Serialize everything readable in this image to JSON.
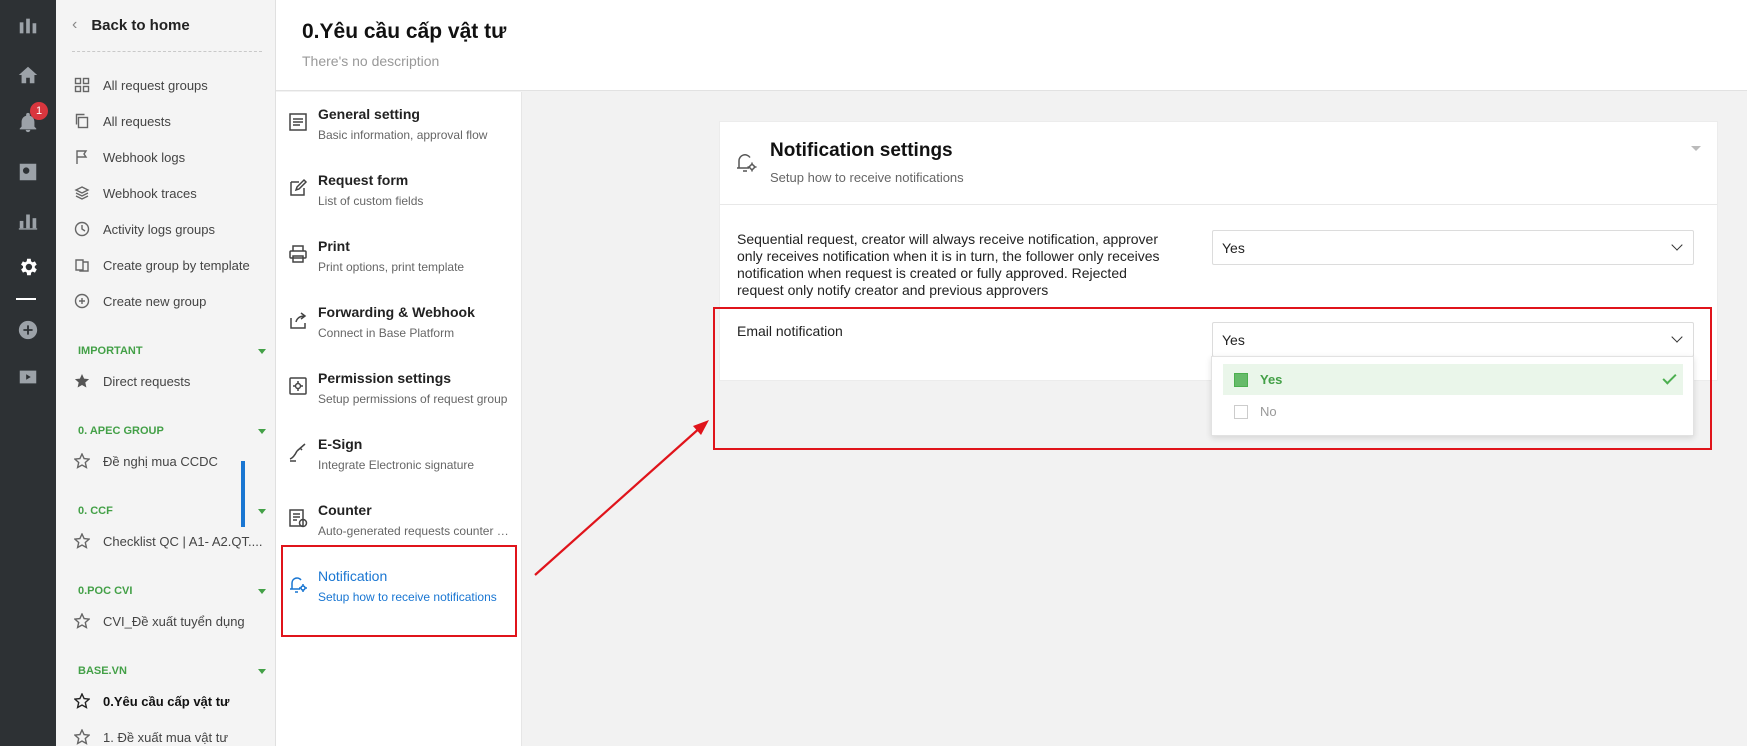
{
  "rail": {
    "notification_badge": "1",
    "icons": [
      "logo-icon",
      "home-icon",
      "bell-icon",
      "search-icon",
      "chart-icon",
      "settings-icon",
      "add-icon",
      "video-icon"
    ]
  },
  "groups_nav": {
    "back_label": "Back to home",
    "items": [
      {
        "label": "All request groups",
        "icon": "grid-icon"
      },
      {
        "label": "All requests",
        "icon": "copy-icon"
      },
      {
        "label": "Webhook logs",
        "icon": "flag-icon"
      },
      {
        "label": "Webhook traces",
        "icon": "layers-icon"
      },
      {
        "label": "Activity logs groups",
        "icon": "clock-icon"
      },
      {
        "label": "Create group by template",
        "icon": "template-icon"
      },
      {
        "label": "Create new group",
        "icon": "plus-circle-icon"
      }
    ],
    "sections": [
      {
        "title": "IMPORTANT",
        "items": [
          "Direct requests"
        ]
      },
      {
        "title": "0. APEC GROUP",
        "items": [
          "Đề nghị mua CCDC"
        ]
      },
      {
        "title": "0. CCF",
        "items": [
          "Checklist QC | A1- A2.QT...."
        ]
      },
      {
        "title": "0.POC CVI",
        "items": [
          "CVI_Đề xuất tuyển dụng"
        ]
      },
      {
        "title": "BASE.VN",
        "items": [
          "0.Yêu cầu cấp vật tư",
          "1. Đề xuất mua vật tư"
        ]
      }
    ]
  },
  "header": {
    "title": "0.Yêu cầu cấp vật tư",
    "description": "There's no description"
  },
  "settings_menu": [
    {
      "title": "General setting",
      "subtitle": "Basic information, approval flow",
      "icon": "document-icon"
    },
    {
      "title": "Request form",
      "subtitle": "List of custom fields",
      "icon": "edit-icon"
    },
    {
      "title": "Print",
      "subtitle": "Print options, print template",
      "icon": "printer-icon"
    },
    {
      "title": "Forwarding & Webhook",
      "subtitle": "Connect in Base Platform",
      "icon": "share-icon"
    },
    {
      "title": "Permission settings",
      "subtitle": "Setup permissions of request group",
      "icon": "gear-box-icon"
    },
    {
      "title": "E-Sign",
      "subtitle": "Integrate Electronic signature",
      "icon": "signature-icon"
    },
    {
      "title": "Counter",
      "subtitle": "Auto-generated requests counter config",
      "icon": "counter-icon"
    },
    {
      "title": "Notification",
      "subtitle": "Setup how to receive notifications",
      "icon": "bell-gear-icon",
      "active": true
    }
  ],
  "notification_card": {
    "title": "Notification settings",
    "subtitle": "Setup how to receive notifications",
    "rows": [
      {
        "label": "Sequential request, creator will always receive notification, approver only receives notification when it is in turn, the follower only receives notification when request is created or fully approved. Rejected request only notify creator and previous approvers",
        "value": "Yes"
      },
      {
        "label": "Email notification",
        "value": "Yes"
      }
    ],
    "dropdown_options": [
      {
        "label": "Yes",
        "selected": true
      },
      {
        "label": "No",
        "selected": false
      }
    ]
  },
  "colors": {
    "accent_blue": "#1976d2",
    "group_green": "#43a047",
    "annotation_red": "#e0141b",
    "rail_bg": "#2d3134"
  }
}
